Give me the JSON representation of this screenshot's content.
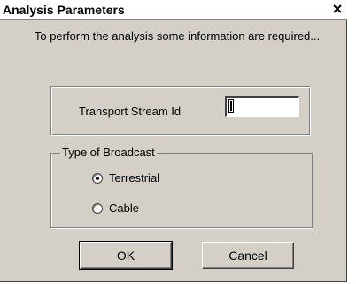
{
  "dialog": {
    "title": "Analysis Parameters",
    "intro": "To perform the analysis some information are required...",
    "transport_stream": {
      "label": "Transport Stream Id",
      "value": "",
      "placeholder": ""
    },
    "broadcast": {
      "legend": "Type of Broadcast",
      "options": [
        {
          "label": "Terrestrial",
          "selected": true
        },
        {
          "label": "Cable",
          "selected": false
        }
      ]
    },
    "buttons": {
      "ok": "OK",
      "cancel": "Cancel"
    }
  },
  "icons": {
    "close": "close-icon",
    "radio": "radio-icon"
  },
  "colors": {
    "face": "#d4d0c8",
    "shadow": "#808080",
    "highlight": "#ffffff"
  }
}
